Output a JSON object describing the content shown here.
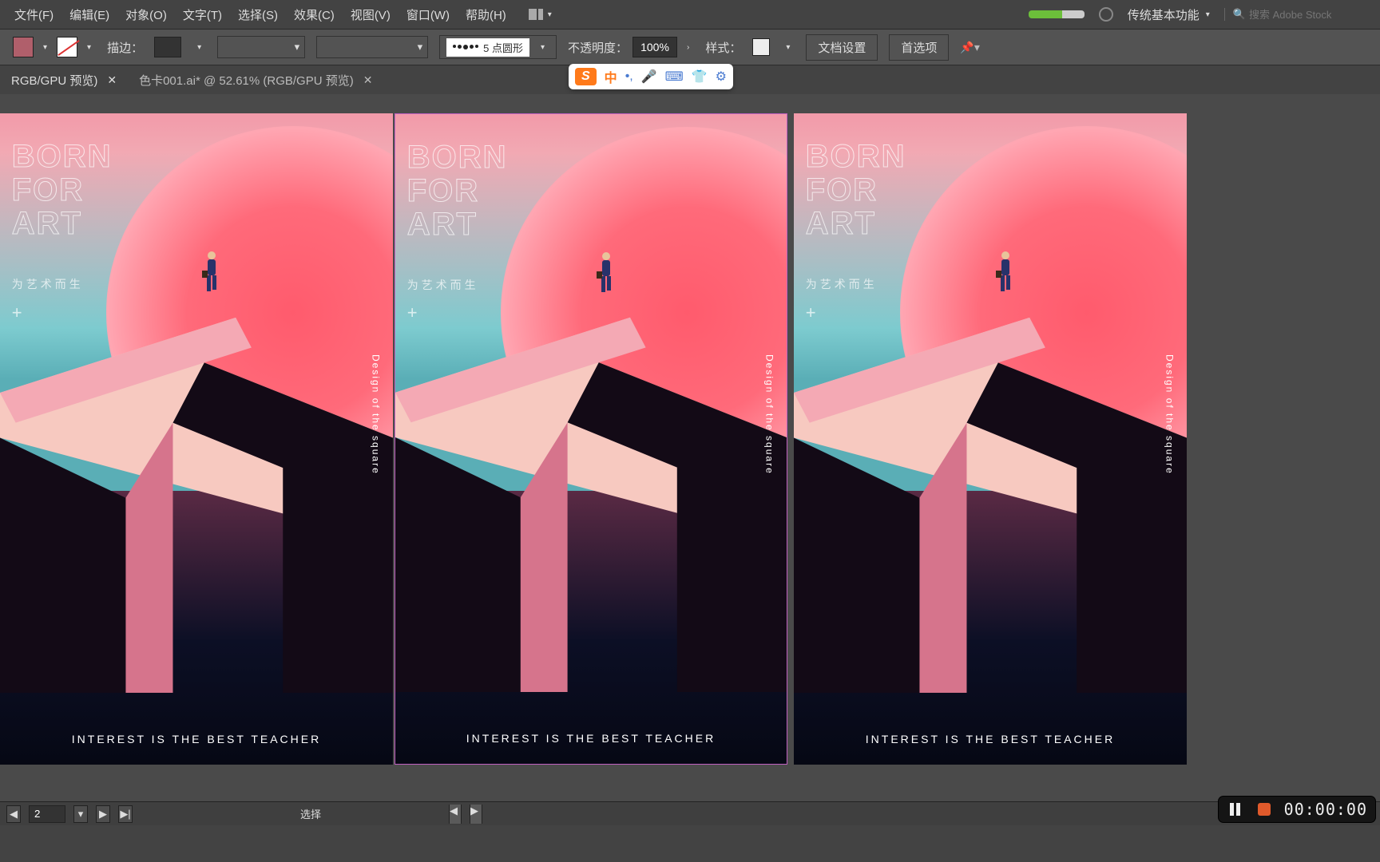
{
  "menubar": {
    "items": [
      "文件(F)",
      "编辑(E)",
      "对象(O)",
      "文字(T)",
      "选择(S)",
      "效果(C)",
      "视图(V)",
      "窗口(W)",
      "帮助(H)"
    ],
    "workspace_label": "传统基本功能",
    "search_placeholder": "搜索 Adobe Stock"
  },
  "optionsbar": {
    "stroke_label": "描边：",
    "brush_name": "5 点圆形",
    "opacity_label": "不透明度：",
    "opacity_value": "100%",
    "style_label": "样式：",
    "doc_setup_btn": "文档设置",
    "prefs_btn": "首选项"
  },
  "tabs": {
    "tab1": "RGB/GPU 预览)",
    "tab2": "色卡001.ai* @ 52.61% (RGB/GPU 预览)"
  },
  "ime": {
    "lang": "中"
  },
  "poster": {
    "title1": "BORN",
    "title2": "FOR",
    "title3": "ART",
    "subtitle_cn": "为艺术而生",
    "plus": "+",
    "vlabel": "Design of the square",
    "footer": "INTEREST IS THE BEST TEACHER"
  },
  "statusbar": {
    "page_value": "2",
    "tool_label": "选择"
  },
  "recorder": {
    "time": "00:00:00"
  }
}
